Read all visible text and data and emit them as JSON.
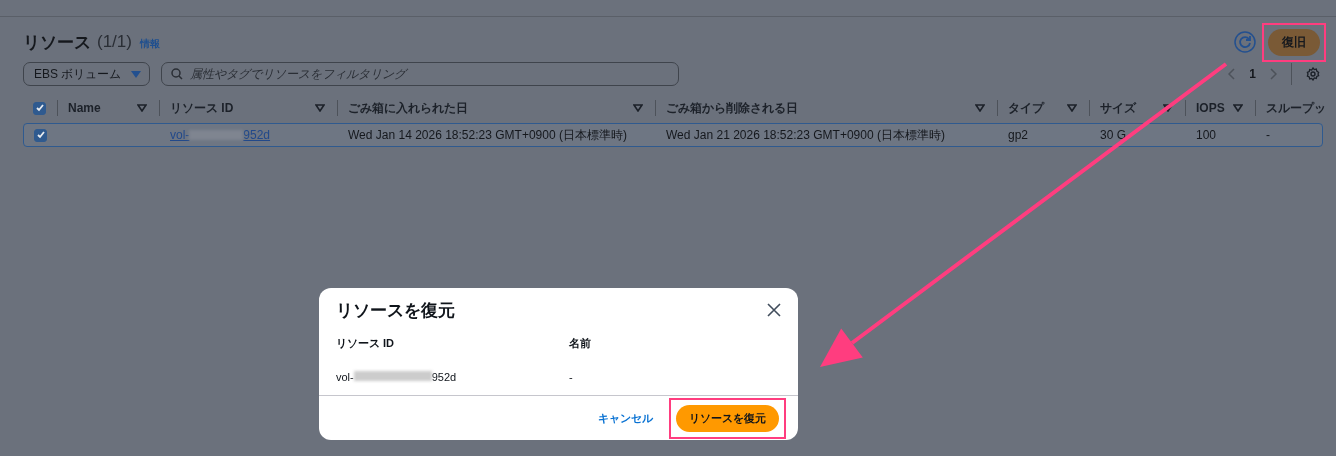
{
  "header": {
    "title": "リソース",
    "count": "(1/1)",
    "info_link": "情報"
  },
  "restore_button": {
    "label": "復旧",
    "highlighted": true
  },
  "filter": {
    "dropdown": "EBS ボリューム",
    "search_placeholder": "属性やタグでリソースをフィルタリング"
  },
  "pagination": {
    "page": "1"
  },
  "table": {
    "select_all_checked": true,
    "columns": [
      "Name",
      "リソース ID",
      "ごみ箱に入れられた日",
      "ごみ箱から削除される日",
      "タイプ",
      "サイズ",
      "IOPS",
      "スループッ"
    ],
    "rows": [
      {
        "selected": true,
        "checked": true,
        "resource_id_start": "vol-",
        "resource_id_end": "952d",
        "trashed_at": "Wed Jan 14 2026 18:52:23 GMT+0900 (日本標準時)",
        "deleted_at": "Wed Jan 21 2026 18:52:23 GMT+0900 (日本標準時)",
        "type": "gp2",
        "size": "30 G",
        "iops": "100",
        "throughput": "-"
      }
    ]
  },
  "dialog": {
    "title": "リソースを復元",
    "columns": [
      "リソース ID",
      "名前"
    ],
    "rows": [
      {
        "resource_id_start": "vol-",
        "resource_id_end": "952d",
        "name": "-"
      }
    ],
    "cancel": "キャンセル",
    "confirm": {
      "label": "リソースを復元",
      "highlighted": true
    }
  }
}
